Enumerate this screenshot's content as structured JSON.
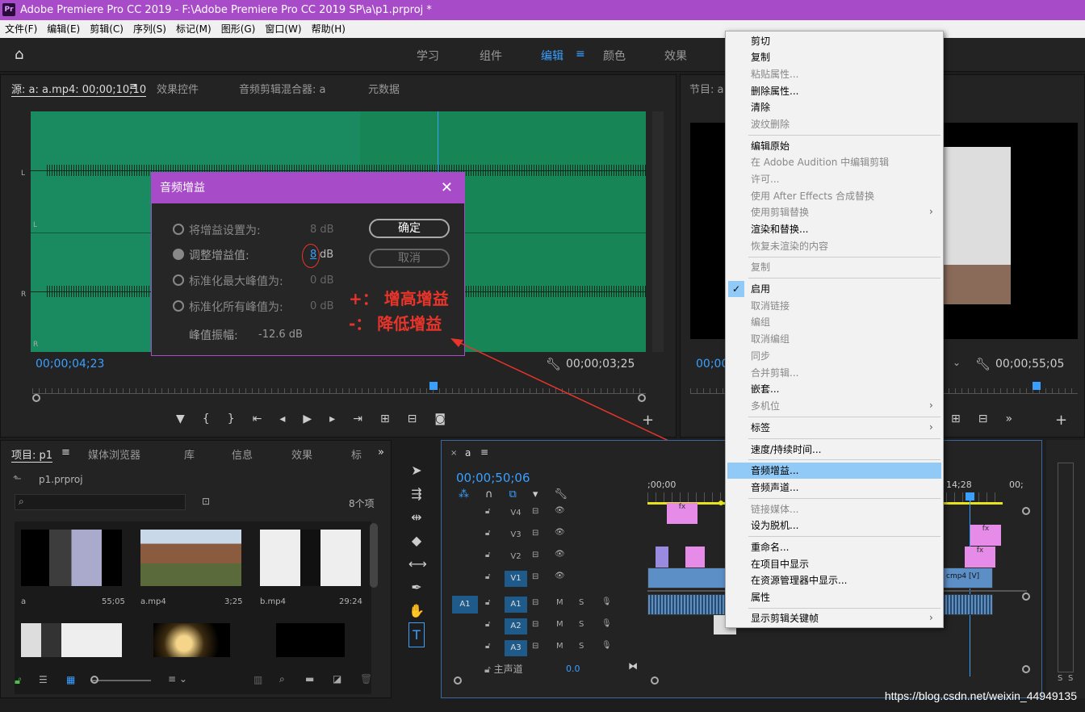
{
  "titlebar": {
    "app_icon": "Pr",
    "title": "Adobe Premiere Pro CC 2019 - F:\\Adobe Premiere Pro CC 2019 SP\\a\\p1.prproj *"
  },
  "menubar": [
    "文件(F)",
    "编辑(E)",
    "剪辑(C)",
    "序列(S)",
    "标记(M)",
    "图形(G)",
    "窗口(W)",
    "帮助(H)"
  ],
  "workspaces": [
    "学习",
    "组件",
    "编辑",
    "颜色",
    "效果"
  ],
  "source": {
    "tabs": [
      "源: a: a.mp4: 00;00;10;10",
      "效果控件",
      "音频剪辑混合器: a",
      "元数据"
    ],
    "time_left": "00;00;04;23",
    "time_right": "00;00;03;25",
    "ch_l": "L",
    "ch_r": "R"
  },
  "dialog": {
    "title": "音频增益",
    "opt1": "将增益设置为:",
    "opt1_val": "8 dB",
    "opt2": "调整增益值:",
    "opt2_val": "8",
    "opt2_unit": "dB",
    "opt3": "标准化最大峰值为:",
    "opt3_val": "0 dB",
    "opt4": "标准化所有峰值为:",
    "opt4_val": "0 dB",
    "peak_label": "峰值振幅:",
    "peak_val": "-12.6 dB",
    "ok": "确定",
    "cancel": "取消"
  },
  "annotation": {
    "plus": "+： 增高增益",
    "minus": "-： 降低增益"
  },
  "program": {
    "tab": "节目: a",
    "time_left": "00;00",
    "time_right": "00;00;55;05"
  },
  "project": {
    "tabs": [
      "项目: p1",
      "媒体浏览器",
      "库",
      "信息",
      "效果",
      "标"
    ],
    "file": "p1.prproj",
    "count": "8个项",
    "items": [
      {
        "name": "a",
        "dur": "55;05"
      },
      {
        "name": "a.mp4",
        "dur": "3;25"
      },
      {
        "name": "b.mp4",
        "dur": "29:24"
      }
    ]
  },
  "timeline": {
    "tab": "a",
    "time": "00;00;50;06",
    "ruler_start": ";00;00",
    "ruler_mid": "14;28",
    "ruler_end": "00;",
    "tracks_v": [
      "V4",
      "V3",
      "V2",
      "V1"
    ],
    "tracks_a": [
      "A1",
      "A2",
      "A3"
    ],
    "src_a": "A1",
    "master": "主声道",
    "master_val": "0.0",
    "clip_label": "cmp4 [V]"
  },
  "context_menu": {
    "items": [
      {
        "label": "剪切",
        "dis": false
      },
      {
        "label": "复制",
        "dis": false
      },
      {
        "label": "粘贴属性...",
        "dis": true
      },
      {
        "label": "删除属性...",
        "dis": false
      },
      {
        "label": "清除",
        "dis": false
      },
      {
        "label": "波纹删除",
        "dis": true
      },
      {
        "label": "编辑原始",
        "dis": false
      },
      {
        "label": "在 Adobe Audition 中编辑剪辑",
        "dis": true
      },
      {
        "label": "许可...",
        "dis": true
      },
      {
        "label": "使用 After Effects 合成替换",
        "dis": true
      },
      {
        "label": "使用剪辑替换",
        "dis": true
      },
      {
        "label": "渲染和替换...",
        "dis": false
      },
      {
        "label": "恢复未渲染的内容",
        "dis": true
      },
      {
        "label": "复制",
        "dis": true
      },
      {
        "label": "启用",
        "dis": false
      },
      {
        "label": "取消链接",
        "dis": true
      },
      {
        "label": "编组",
        "dis": true
      },
      {
        "label": "取消编组",
        "dis": true
      },
      {
        "label": "同步",
        "dis": true
      },
      {
        "label": "合并剪辑...",
        "dis": true
      },
      {
        "label": "嵌套...",
        "dis": false
      },
      {
        "label": "多机位",
        "dis": true
      },
      {
        "label": "标签",
        "dis": false
      },
      {
        "label": "速度/持续时间...",
        "dis": false
      },
      {
        "label": "音频增益...",
        "dis": false
      },
      {
        "label": "音频声道...",
        "dis": false
      },
      {
        "label": "链接媒体...",
        "dis": true
      },
      {
        "label": "设为脱机...",
        "dis": false
      },
      {
        "label": "重命名...",
        "dis": false
      },
      {
        "label": "在项目中显示",
        "dis": false
      },
      {
        "label": "在资源管理器中显示...",
        "dis": false
      },
      {
        "label": "属性",
        "dis": false
      },
      {
        "label": "显示剪辑关键帧",
        "dis": false
      }
    ],
    "check_mark": "✓",
    "highlight_color": "#91c9f7"
  },
  "right_meter": {
    "s1": "S",
    "s2": "S"
  },
  "watermark": "https://blog.csdn.net/weixin_44949135",
  "colors": {
    "accent": "#a84bc8",
    "wave": "#1a8a60",
    "annotation": "#e8342a",
    "timeline_blue": "#3aa0ff"
  }
}
